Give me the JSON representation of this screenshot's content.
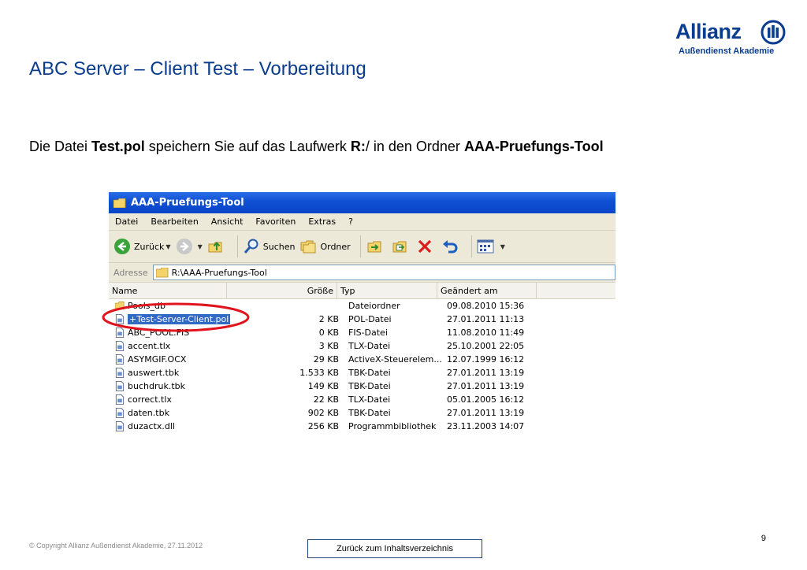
{
  "slide": {
    "title": "ABC Server – Client Test – Vorbereitung",
    "instruction": {
      "t1": "Die Datei ",
      "b1": "Test.pol",
      "t2": " speichern Sie auf das Laufwerk ",
      "b2": "R:",
      "t3": "/ in den Ordner ",
      "b3": "AAA-Pruefungs-Tool"
    },
    "page_number": "9",
    "copyright": "© Copyright Allianz Außendienst Akademie, 27.11.2012",
    "toc_button": "Zurück zum Inhaltsverzeichnis"
  },
  "logo": {
    "word": "Allianz",
    "sub": "Außendienst Akademie",
    "color": "#0a3d8f"
  },
  "explorer": {
    "window_title": "AAA-Pruefungs-Tool",
    "menu": [
      "Datei",
      "Bearbeiten",
      "Ansicht",
      "Favoriten",
      "Extras",
      "?"
    ],
    "toolbar": {
      "back": "Zurück",
      "search": "Suchen",
      "folders": "Ordner"
    },
    "address_label": "Adresse",
    "address_value": "R:\\AAA-Pruefungs-Tool",
    "columns": {
      "name": "Name",
      "size": "Größe",
      "type": "Typ",
      "modified": "Geändert am"
    },
    "files": [
      {
        "name": "Pools_db",
        "size": "",
        "type": "Dateiordner",
        "modified": "09.08.2010 15:36",
        "icon": "folder-icon"
      },
      {
        "name": "+Test-Server-Client.pol",
        "size": "2 KB",
        "type": "POL-Datei",
        "modified": "27.01.2011 11:13",
        "icon": "file-icon",
        "selected": true
      },
      {
        "name": "ABC_POOL.FIS",
        "size": "0 KB",
        "type": "FIS-Datei",
        "modified": "11.08.2010 11:49",
        "icon": "file-icon"
      },
      {
        "name": "accent.tlx",
        "size": "3 KB",
        "type": "TLX-Datei",
        "modified": "25.10.2001 22:05",
        "icon": "file-icon"
      },
      {
        "name": "ASYMGIF.OCX",
        "size": "29 KB",
        "type": "ActiveX-Steuerelem...",
        "modified": "12.07.1999 16:12",
        "icon": "file-icon"
      },
      {
        "name": "auswert.tbk",
        "size": "1.533 KB",
        "type": "TBK-Datei",
        "modified": "27.01.2011 13:19",
        "icon": "file-icon"
      },
      {
        "name": "buchdruk.tbk",
        "size": "149 KB",
        "type": "TBK-Datei",
        "modified": "27.01.2011 13:19",
        "icon": "file-icon"
      },
      {
        "name": "correct.tlx",
        "size": "22 KB",
        "type": "TLX-Datei",
        "modified": "05.01.2005 16:12",
        "icon": "file-icon"
      },
      {
        "name": "daten.tbk",
        "size": "902 KB",
        "type": "TBK-Datei",
        "modified": "27.01.2011 13:19",
        "icon": "file-icon"
      },
      {
        "name": "duzactx.dll",
        "size": "256 KB",
        "type": "Programmbibliothek",
        "modified": "23.11.2003 14:07",
        "icon": "file-icon"
      }
    ]
  },
  "colors": {
    "title": "#0a3d8f",
    "highlight_ring": "#e0141c",
    "selection": "#316ac5"
  }
}
